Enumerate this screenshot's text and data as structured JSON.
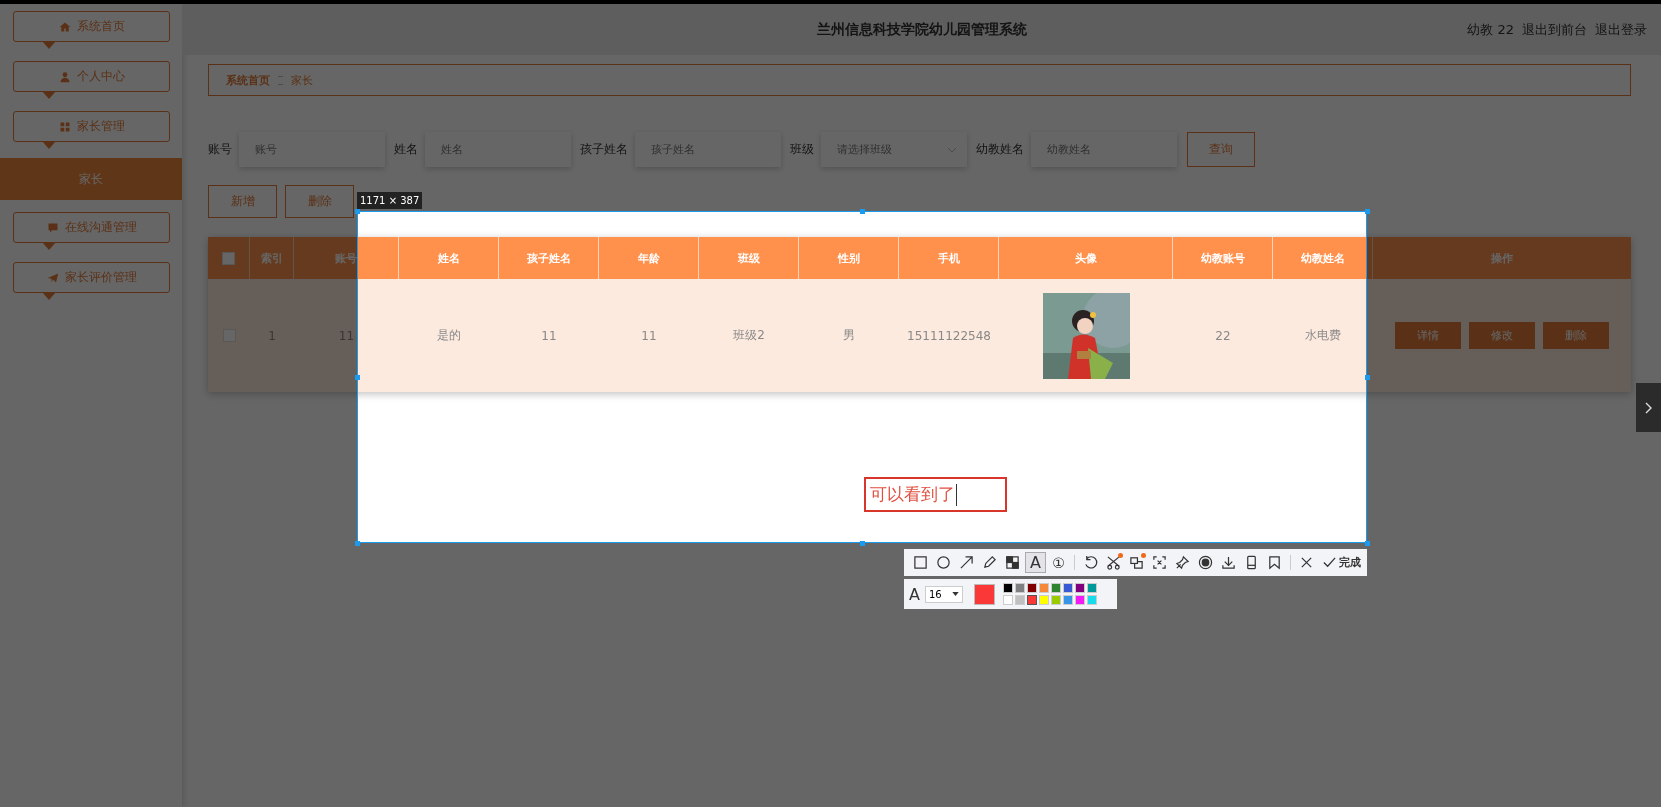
{
  "header": {
    "title": "兰州信息科技学院幼儿园管理系统",
    "user": "幼教 22",
    "links": [
      "退出到前台",
      "退出登录"
    ]
  },
  "sidebar": {
    "items": [
      {
        "label": "系统首页",
        "kind": "home",
        "selected": false
      },
      {
        "label": "个人中心",
        "kind": "user",
        "selected": false
      },
      {
        "label": "家长管理",
        "kind": "grid",
        "selected": false
      },
      {
        "label": "家长",
        "kind": "submenu",
        "selected": true
      },
      {
        "label": "在线沟通管理",
        "kind": "chat",
        "selected": false
      },
      {
        "label": "家长评价管理",
        "kind": "send",
        "selected": false
      }
    ]
  },
  "breadcrumb": [
    "系统首页",
    "家长"
  ],
  "search": {
    "fields": [
      {
        "label": "账号",
        "kind": "input",
        "placeholder": "账号"
      },
      {
        "label": "姓名",
        "kind": "input",
        "placeholder": "姓名"
      },
      {
        "label": "孩子姓名",
        "kind": "input",
        "placeholder": "孩子姓名"
      },
      {
        "label": "班级",
        "kind": "select",
        "placeholder": "请选择班级"
      },
      {
        "label": "幼教姓名",
        "kind": "input",
        "placeholder": "幼教姓名"
      }
    ],
    "button": "查询"
  },
  "actions": [
    "新增",
    "删除"
  ],
  "table": {
    "all_checked": false,
    "columns": [
      "索引",
      "账号",
      "姓名",
      "孩子姓名",
      "年龄",
      "班级",
      "性别",
      "手机",
      "头像",
      "幼教账号",
      "幼教姓名",
      "操作"
    ],
    "rows": [
      {
        "checked": false,
        "cells": [
          {
            "kind": "text",
            "text": "1"
          },
          {
            "kind": "text",
            "text": "11"
          },
          {
            "kind": "text",
            "text": "是的"
          },
          {
            "kind": "text",
            "text": "11"
          },
          {
            "kind": "text",
            "text": "11"
          },
          {
            "kind": "text",
            "text": "班级2"
          },
          {
            "kind": "text",
            "text": "男"
          },
          {
            "kind": "text",
            "text": "15111122548"
          },
          {
            "kind": "picture"
          },
          {
            "kind": "text",
            "text": "22"
          },
          {
            "kind": "text",
            "text": "水电费"
          },
          {
            "kind": "actions",
            "buttons": [
              "详情",
              "修改",
              "删除"
            ]
          }
        ]
      }
    ]
  },
  "capture": {
    "size": "1171 × 387",
    "annotation": "可以看到了"
  },
  "toolbar": {
    "groups": [
      {
        "tools": [
          {
            "kind": "rect",
            "selected": false,
            "badge": false
          },
          {
            "kind": "ellipse",
            "selected": false,
            "badge": false
          },
          {
            "kind": "arrow",
            "selected": false,
            "badge": false
          },
          {
            "kind": "pen",
            "selected": false,
            "badge": false
          },
          {
            "kind": "mosaic",
            "selected": false,
            "badge": false
          },
          {
            "kind": "text",
            "label": "A",
            "selected": true,
            "badge": false
          },
          {
            "kind": "number",
            "label": "①",
            "selected": false,
            "badge": false
          }
        ]
      },
      {
        "tools": [
          {
            "kind": "undo",
            "selected": false,
            "badge": false
          },
          {
            "kind": "cutout",
            "selected": false,
            "badge": true
          },
          {
            "kind": "ocr",
            "selected": false,
            "badge": true
          },
          {
            "kind": "crop",
            "selected": false,
            "badge": false
          },
          {
            "kind": "pin",
            "selected": false,
            "badge": false
          },
          {
            "kind": "record",
            "selected": false,
            "badge": false
          },
          {
            "kind": "download",
            "selected": false,
            "badge": false
          },
          {
            "kind": "phone",
            "selected": false,
            "badge": false
          },
          {
            "kind": "bookmark",
            "selected": false,
            "badge": false
          }
        ]
      },
      {
        "tools": [
          {
            "kind": "cancel",
            "selected": false,
            "badge": false
          },
          {
            "kind": "done",
            "label": "完成",
            "selected": false,
            "badge": false
          }
        ]
      }
    ]
  },
  "text_options": {
    "font_icon": "A",
    "font_size": "16",
    "colors": [
      {
        "color": "#000000",
        "selected": false
      },
      {
        "color": "#808080",
        "selected": false
      },
      {
        "color": "#800000",
        "selected": false
      },
      {
        "color": "#f7883a",
        "selected": false
      },
      {
        "color": "#308430",
        "selected": false
      },
      {
        "color": "#385ad3",
        "selected": false
      },
      {
        "color": "#800080",
        "selected": false
      },
      {
        "color": "#009999",
        "selected": false
      },
      {
        "color": "#ffffff",
        "selected": false
      },
      {
        "color": "#c0c0c0",
        "selected": false
      },
      {
        "color": "#fb3838",
        "selected": true
      },
      {
        "color": "#ffff00",
        "selected": false
      },
      {
        "color": "#99cc00",
        "selected": false
      },
      {
        "color": "#3894e4",
        "selected": false
      },
      {
        "color": "#f31bf3",
        "selected": false
      },
      {
        "color": "#16dcee",
        "selected": false
      }
    ]
  }
}
